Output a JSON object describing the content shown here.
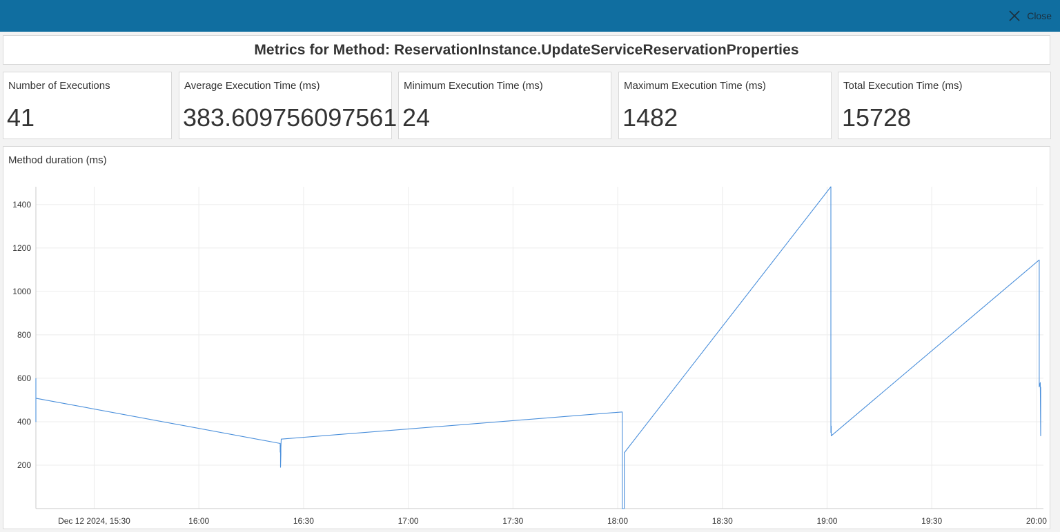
{
  "header": {
    "close_label": "Close",
    "bar_color": "#106ea0",
    "close_icon": "close-icon"
  },
  "title": "Metrics for Method: ReservationInstance.UpdateServiceReservationProperties",
  "metrics": [
    {
      "label": "Number of Executions",
      "value": "41"
    },
    {
      "label": "Average Execution Time (ms)",
      "value": "383.609756097561"
    },
    {
      "label": "Minimum Execution Time (ms)",
      "value": "24"
    },
    {
      "label": "Maximum Execution Time (ms)",
      "value": "1482"
    },
    {
      "label": "Total Execution Time (ms)",
      "value": "15728"
    }
  ],
  "chart_title": "Method duration (ms)",
  "chart_data": {
    "type": "line",
    "xlabel": "",
    "ylabel": "",
    "x_unit": "minutes after 15:30 (axis labels show clock time)",
    "xlim": [
      -16.7,
      272
    ],
    "ylim": [
      0,
      1482
    ],
    "grid": true,
    "line_color": "#4a8fdb",
    "x_tick_values": [
      0,
      30,
      60,
      90,
      120,
      150,
      180,
      210,
      240,
      270
    ],
    "x_tick_labels": [
      "Dec 12 2024, 15:30",
      "16:00",
      "16:30",
      "17:00",
      "17:30",
      "18:00",
      "18:30",
      "19:00",
      "19:30",
      "20:00"
    ],
    "y_ticks": [
      200,
      400,
      600,
      800,
      1000,
      1200,
      1400
    ],
    "series": [
      {
        "name": "",
        "x": [
          -16.7,
          -16.7,
          -16.7,
          -16.7,
          53.3,
          53.3,
          53.4,
          53.4,
          53.5,
          53.5,
          53.6,
          151.3,
          151.3,
          151.9,
          151.9,
          151.9,
          211.1,
          211.1,
          211.2,
          211.2,
          270.8,
          270.8,
          271.1,
          271.2,
          271.2
        ],
        "y": [
          600,
          400,
          580,
          508,
          300,
          260,
          290,
          190,
          250,
          280,
          320,
          445,
          0,
          0,
          60,
          257,
          1482,
          350,
          380,
          335,
          1145,
          560,
          580,
          335,
          560
        ]
      }
    ]
  }
}
